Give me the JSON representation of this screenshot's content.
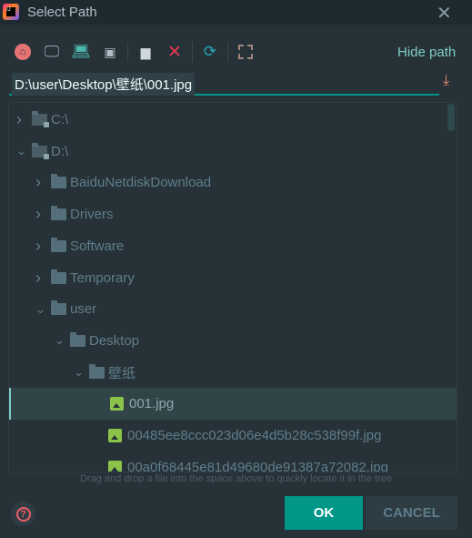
{
  "window": {
    "title": "Select Path",
    "close_icon": "close-icon"
  },
  "toolbar": {
    "icons": [
      "home-icon",
      "desktop-icon",
      "project-icon",
      "module-icon",
      "new-folder-icon",
      "delete-icon",
      "refresh-icon",
      "toggle-hidden-icon"
    ],
    "hide_path_label": "Hide path"
  },
  "path_field": {
    "value": "D:\\user\\Desktop\\壁纸\\001.jpg"
  },
  "tree": {
    "items": [
      {
        "label": "C:\\",
        "level": 0,
        "type": "drive",
        "expanded": false
      },
      {
        "label": "D:\\",
        "level": 0,
        "type": "drive",
        "expanded": true
      },
      {
        "label": "BaiduNetdiskDownload",
        "level": 1,
        "type": "folder",
        "expanded": false
      },
      {
        "label": "Drivers",
        "level": 1,
        "type": "folder",
        "expanded": false
      },
      {
        "label": "Software",
        "level": 1,
        "type": "folder",
        "expanded": false
      },
      {
        "label": "Temporary",
        "level": 1,
        "type": "folder",
        "expanded": false
      },
      {
        "label": "user",
        "level": 1,
        "type": "folder",
        "expanded": true
      },
      {
        "label": "Desktop",
        "level": 2,
        "type": "folder",
        "expanded": true
      },
      {
        "label": "壁纸",
        "level": 3,
        "type": "folder",
        "expanded": true
      },
      {
        "label": "001.jpg",
        "level": 4,
        "type": "image",
        "selected": true
      },
      {
        "label": "00485ee8ccc023d06e4d5b28c538f99f.jpg",
        "level": 4,
        "type": "image"
      },
      {
        "label": "00a0f68445e81d49680de91387a72082.jpg",
        "level": 4,
        "type": "image"
      }
    ]
  },
  "hint": "Drag and drop a file into the space above to quickly locate it in the tree",
  "buttons": {
    "ok": "OK",
    "cancel": "CANCEL"
  },
  "colors": {
    "accent": "#009688",
    "background": "#263238",
    "selection": "#314549"
  }
}
